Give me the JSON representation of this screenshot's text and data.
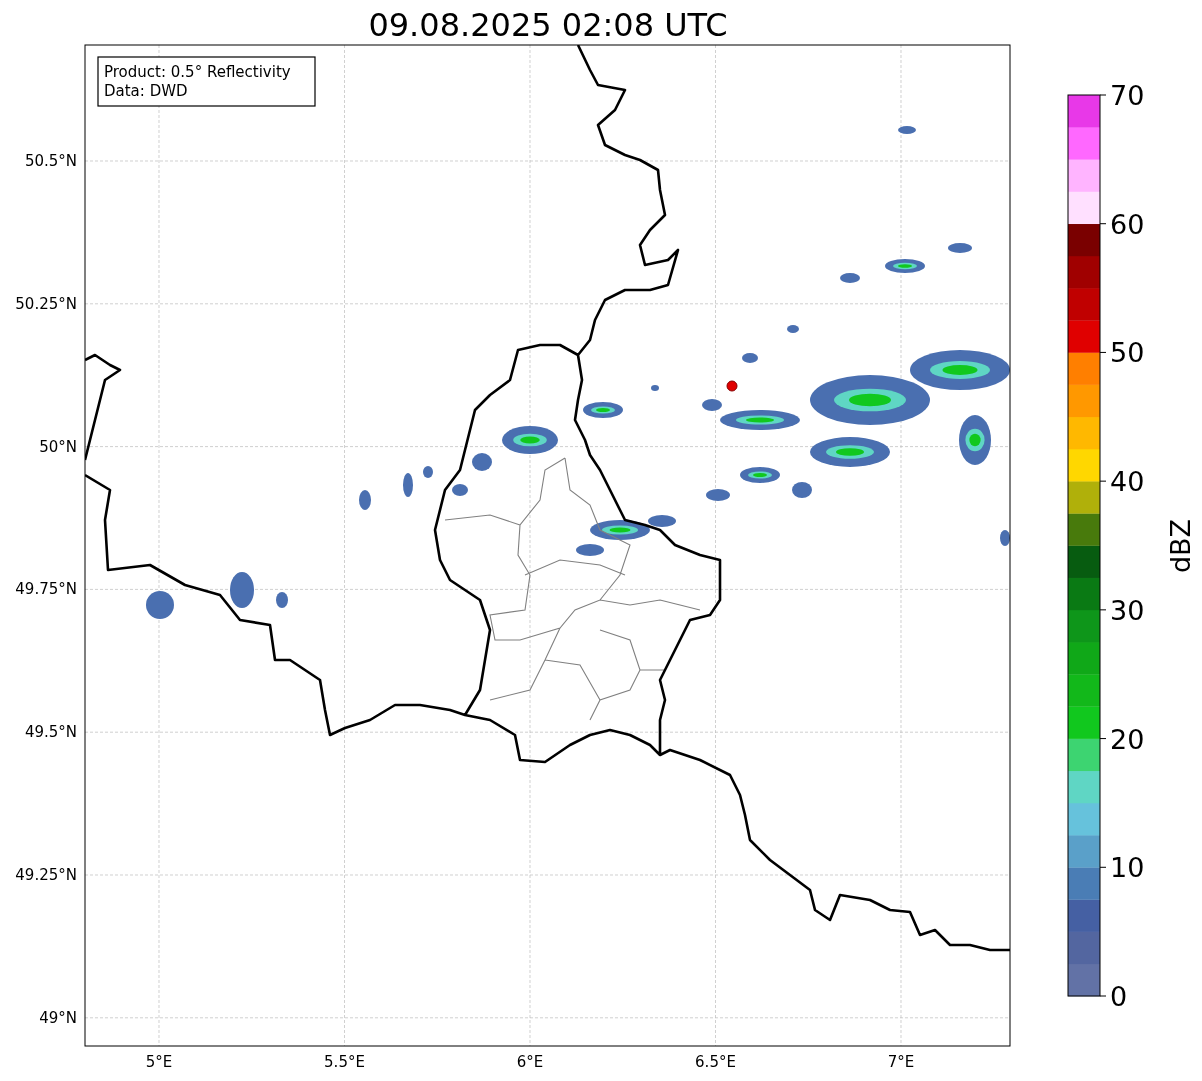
{
  "title": "09.08.2025 02:08 UTC",
  "info_box": [
    "Product: 0.5° Reflectivity",
    "Data: DWD"
  ],
  "x_ticks": [
    "5°E",
    "5.5°E",
    "6°E",
    "6.5°E",
    "7°E"
  ],
  "y_ticks": [
    "50.5°N",
    "50.25°N",
    "50°N",
    "49.75°N",
    "49.5°N",
    "49.25°N",
    "49°N"
  ],
  "colorbar": {
    "label": "dBZ",
    "ticks": [
      "70",
      "60",
      "50",
      "40",
      "30",
      "20",
      "10",
      "0"
    ],
    "bins": [
      {
        "color": "#6272a6"
      },
      {
        "color": "#5366a0"
      },
      {
        "color": "#4560a3"
      },
      {
        "color": "#4a7db5"
      },
      {
        "color": "#5aa0c9"
      },
      {
        "color": "#66c2dc"
      },
      {
        "color": "#5fd6c4"
      },
      {
        "color": "#3dd471"
      },
      {
        "color": "#11c81e"
      },
      {
        "color": "#12b81a"
      },
      {
        "color": "#10a818"
      },
      {
        "color": "#0e961a"
      },
      {
        "color": "#0a7a14"
      },
      {
        "color": "#075c10"
      },
      {
        "color": "#487a0c"
      },
      {
        "color": "#b0b00a"
      },
      {
        "color": "#ffd700"
      },
      {
        "color": "#ffb800"
      },
      {
        "color": "#ff9800"
      },
      {
        "color": "#ff7f00"
      },
      {
        "color": "#e00000"
      },
      {
        "color": "#c00000"
      },
      {
        "color": "#a00000"
      },
      {
        "color": "#7a0000"
      },
      {
        "color": "#ffe0ff"
      },
      {
        "color": "#ffb4ff"
      },
      {
        "color": "#ff68ff"
      },
      {
        "color": "#e838e8"
      }
    ]
  }
}
